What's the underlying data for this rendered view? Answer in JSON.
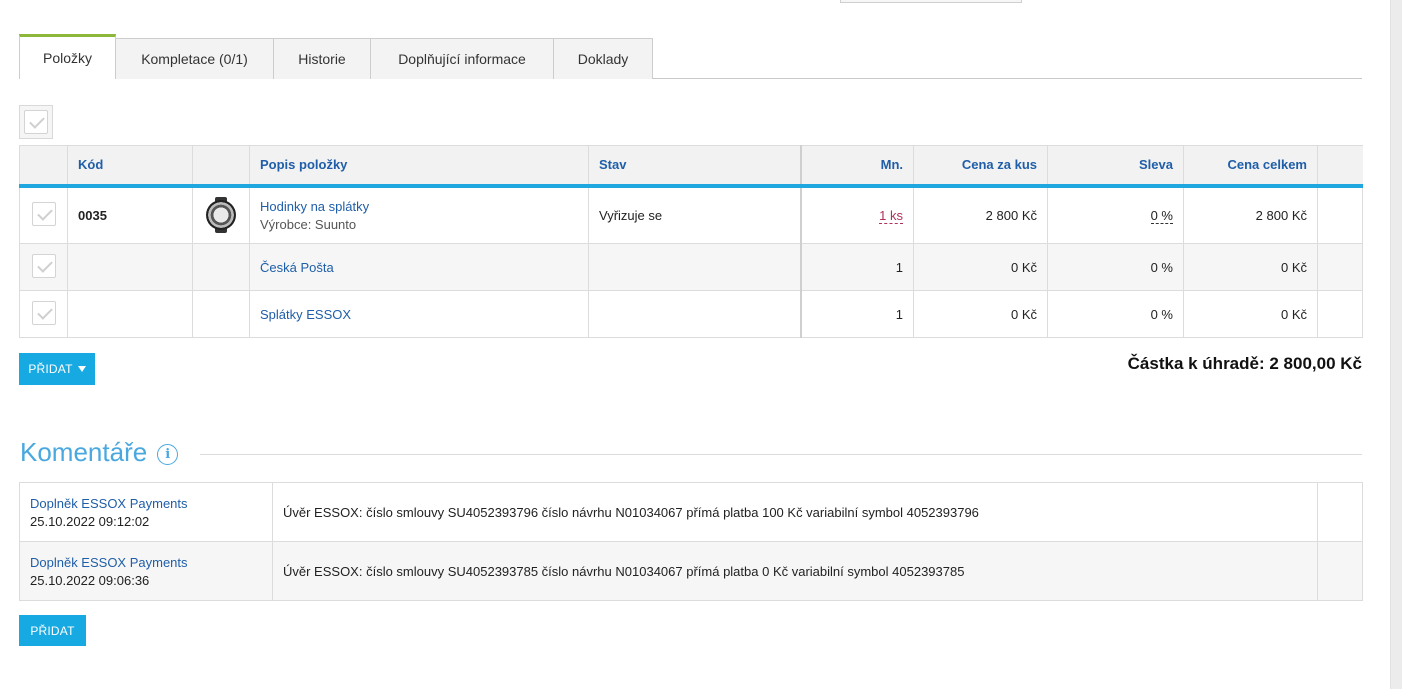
{
  "tabs": [
    {
      "label": "Položky",
      "active": true
    },
    {
      "label": "Kompletace (0/1)",
      "active": false
    },
    {
      "label": "Historie",
      "active": false
    },
    {
      "label": "Doplňující informace",
      "active": false
    },
    {
      "label": "Doklady",
      "active": false
    }
  ],
  "items_table": {
    "headers": {
      "code": "Kód",
      "description": "Popis položky",
      "status": "Stav",
      "quantity": "Mn.",
      "unit_price": "Cena za kus",
      "discount": "Sleva",
      "total": "Cena celkem"
    },
    "rows": [
      {
        "code": "0035",
        "name": "Hodinky na splátky",
        "manufacturer": "Výrobce: Suunto",
        "status": "Vyřizuje se",
        "quantity": "1 ks",
        "unit_price": "2 800 Kč",
        "discount": "0 %",
        "total": "2 800 Kč"
      },
      {
        "code": "",
        "name": "Česká Pošta",
        "status": "",
        "quantity": "1",
        "unit_price": "0 Kč",
        "discount": "0 %",
        "total": "0 Kč"
      },
      {
        "code": "",
        "name": "Splátky ESSOX",
        "status": "",
        "quantity": "1",
        "unit_price": "0 Kč",
        "discount": "0 %",
        "total": "0 Kč"
      }
    ]
  },
  "add_item_button": "PŘIDAT",
  "amount_due": "Částka k úhradě: 2 800,00 Kč",
  "comments": {
    "title": "Komentáře",
    "info_icon": "info-icon",
    "rows": [
      {
        "author": "Doplněk ESSOX Payments",
        "datetime": "25.10.2022 09:12:02",
        "text": "Úvěr ESSOX: číslo smlouvy SU4052393796 číslo návrhu N01034067 přímá platba 100 Kč variabilní symbol 4052393796"
      },
      {
        "author": "Doplněk ESSOX Payments",
        "datetime": "25.10.2022 09:06:36",
        "text": "Úvěr ESSOX: číslo smlouvy SU4052393785 číslo návrhu N01034067 přímá platba 0 Kč variabilní symbol 4052393785"
      }
    ],
    "add_button": "PŘIDAT"
  },
  "colors": {
    "accent_blue": "#17a9e1",
    "link_blue": "#1f5ea8",
    "active_tab_green": "#8cb73a",
    "total_green": "#6d9c3d"
  }
}
